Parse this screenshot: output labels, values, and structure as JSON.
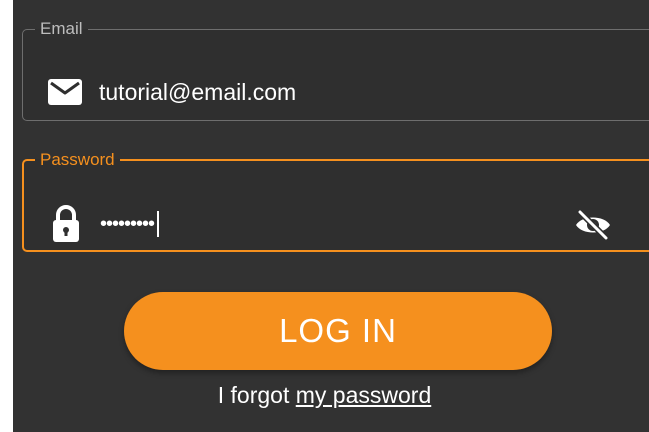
{
  "colors": {
    "background": "#323232",
    "accent": "#f5901e",
    "text": "#ffffff",
    "idle_border": "#6e6e6e",
    "idle_label": "#bdbdbd"
  },
  "email": {
    "label": "Email",
    "value": "tutorial@email.com",
    "icon": "envelope-icon"
  },
  "password": {
    "label": "Password",
    "masked_value": "•••••••••",
    "icon": "lock-icon",
    "toggle_icon": "eye-off-icon",
    "focused": true
  },
  "login_button": {
    "label": "LOG IN"
  },
  "forgot": {
    "prefix": "I forgot ",
    "link": "my password"
  }
}
